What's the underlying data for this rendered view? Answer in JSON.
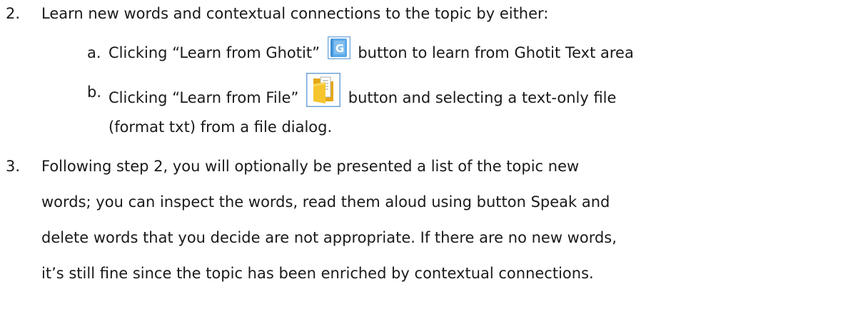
{
  "items": [
    {
      "number": "2.",
      "text": "Learn new words and contextual connections to the topic by either:",
      "subitems": [
        {
          "letter": "a.",
          "before_icon": "Clicking “Learn from Ghotit”",
          "icon": "ghotit-book-icon",
          "after_icon": "button to learn from Ghotit Text area"
        },
        {
          "letter": "b.",
          "before_icon": "Clicking “Learn from File”",
          "icon": "folder-file-icon",
          "after_icon": "button and selecting a text-only file",
          "continuation": "(format txt) from a file dialog."
        }
      ]
    },
    {
      "number": "3.",
      "lines": [
        "Following step 2, you will optionally be presented a list of the topic new",
        "words; you can inspect the words, read them aloud using button Speak and",
        "delete words that you decide are not appropriate. If there are no new words,",
        "it’s still fine since the topic has been enriched by contextual connections."
      ]
    }
  ],
  "icons": {
    "ghotit_letter": "G",
    "ghotit_color": "#3b8fd6",
    "folder_color": "#f6c52e",
    "frame_color": "#6fa3d8"
  }
}
